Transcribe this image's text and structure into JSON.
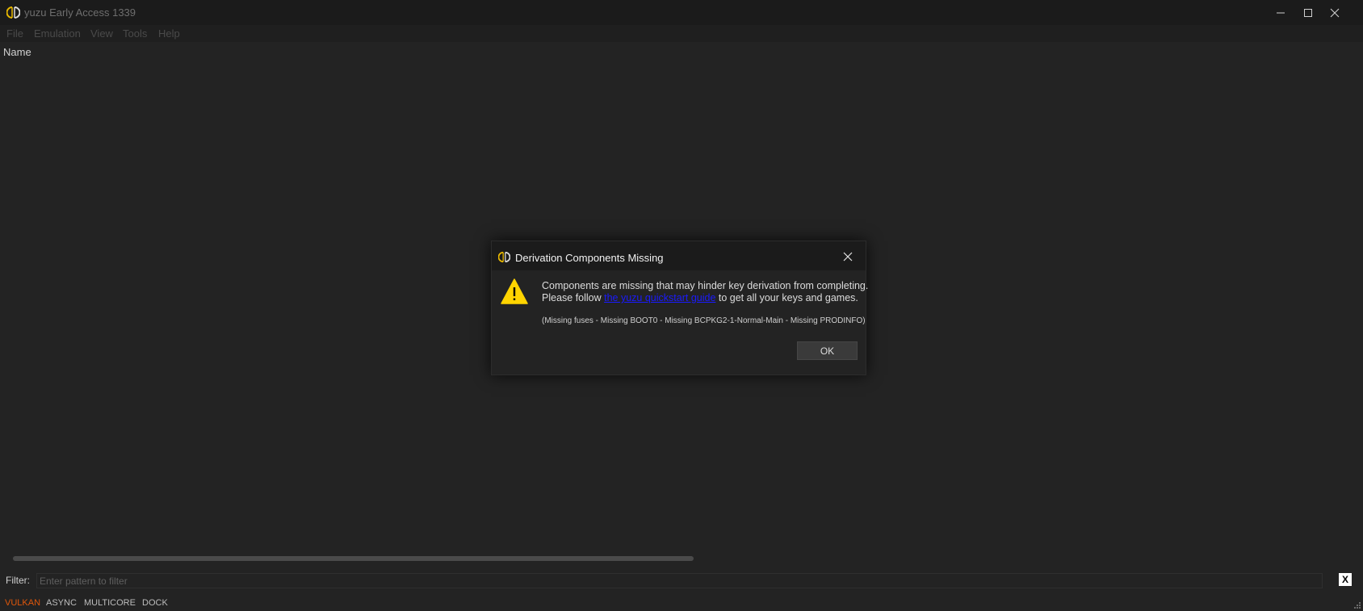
{
  "window": {
    "title": "yuzu Early Access 1339",
    "controls": [
      "minimize-icon",
      "maximize-icon",
      "close-icon"
    ]
  },
  "menu": {
    "items": [
      "File",
      "Emulation",
      "View",
      "Tools",
      "Help"
    ]
  },
  "game_list": {
    "columns": [
      "Name"
    ]
  },
  "filter": {
    "label": "Filter:",
    "placeholder": "Enter pattern to filter",
    "value": "",
    "clear_label": "X"
  },
  "status_bar": {
    "items": [
      "VULKAN",
      "ASYNC",
      "MULTICORE",
      "DOCK"
    ],
    "active_color": "#e0570b"
  },
  "dialog": {
    "title": "Derivation Components Missing",
    "icon": "warning-icon",
    "message_line1": "Components are missing that may hinder key derivation from completing.",
    "message_line2_prefix": "Please follow ",
    "link_text": "the yuzu quickstart guide",
    "message_line2_suffix": " to get all your keys and games.",
    "detail": "(Missing fuses - Missing BOOT0 - Missing BCPKG2-1-Normal-Main - Missing PRODINFO)",
    "ok_label": "OK"
  },
  "colors": {
    "background": "#232323",
    "titlebar": "#1b1b1b",
    "logo": "#e8b800",
    "warning": "#ffd400",
    "link": "#1a1aff"
  }
}
